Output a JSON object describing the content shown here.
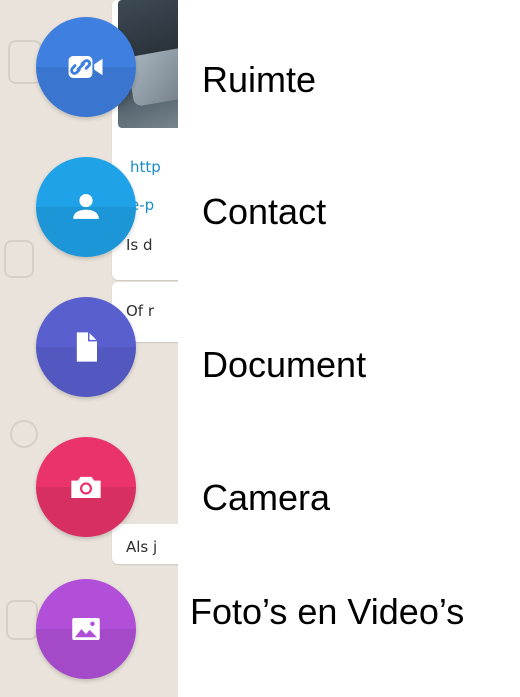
{
  "colors": {
    "ruimte": "#3f7fe0",
    "contact": "#1fa2e8",
    "document": "#5a5fd0",
    "camera": "#e9336a",
    "media": "#b14fd8",
    "link": "#1a8ecb",
    "chat_background": "#e9e3db"
  },
  "chat": {
    "link_line_1": "http",
    "link_line_2": "e-p",
    "message_1": "Is d",
    "message_2": "Of r",
    "message_3": "Als j"
  },
  "attachments": [
    {
      "label": "Ruimte",
      "icon": "video-link-icon"
    },
    {
      "label": "Contact",
      "icon": "person-icon"
    },
    {
      "label": "Document",
      "icon": "document-icon"
    },
    {
      "label": "Camera",
      "icon": "camera-icon"
    },
    {
      "label": "Foto’s en Video’s",
      "icon": "image-icon"
    }
  ]
}
